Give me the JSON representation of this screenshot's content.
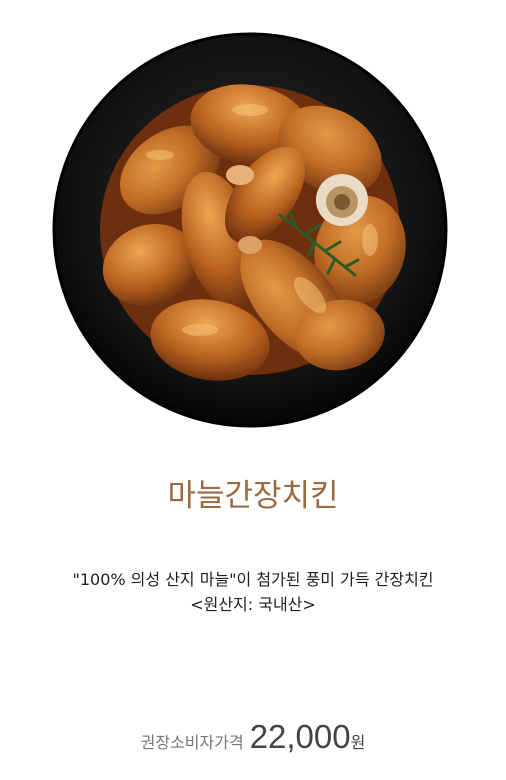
{
  "product": {
    "image_icon": "fried-chicken-plate-image",
    "name": "마늘간장치킨",
    "description_line1": "\"100% 의성 산지 마늘\"이 첨가된 풍미 가득 간장치킨",
    "description_line2": "<원산지: 국내산>",
    "price_label": "권장소비자가격",
    "price_value": "22,000",
    "price_unit": "원"
  },
  "colors": {
    "name": "#9b6a3e",
    "plate": "#0f0f10",
    "chicken": "#c4742c"
  }
}
